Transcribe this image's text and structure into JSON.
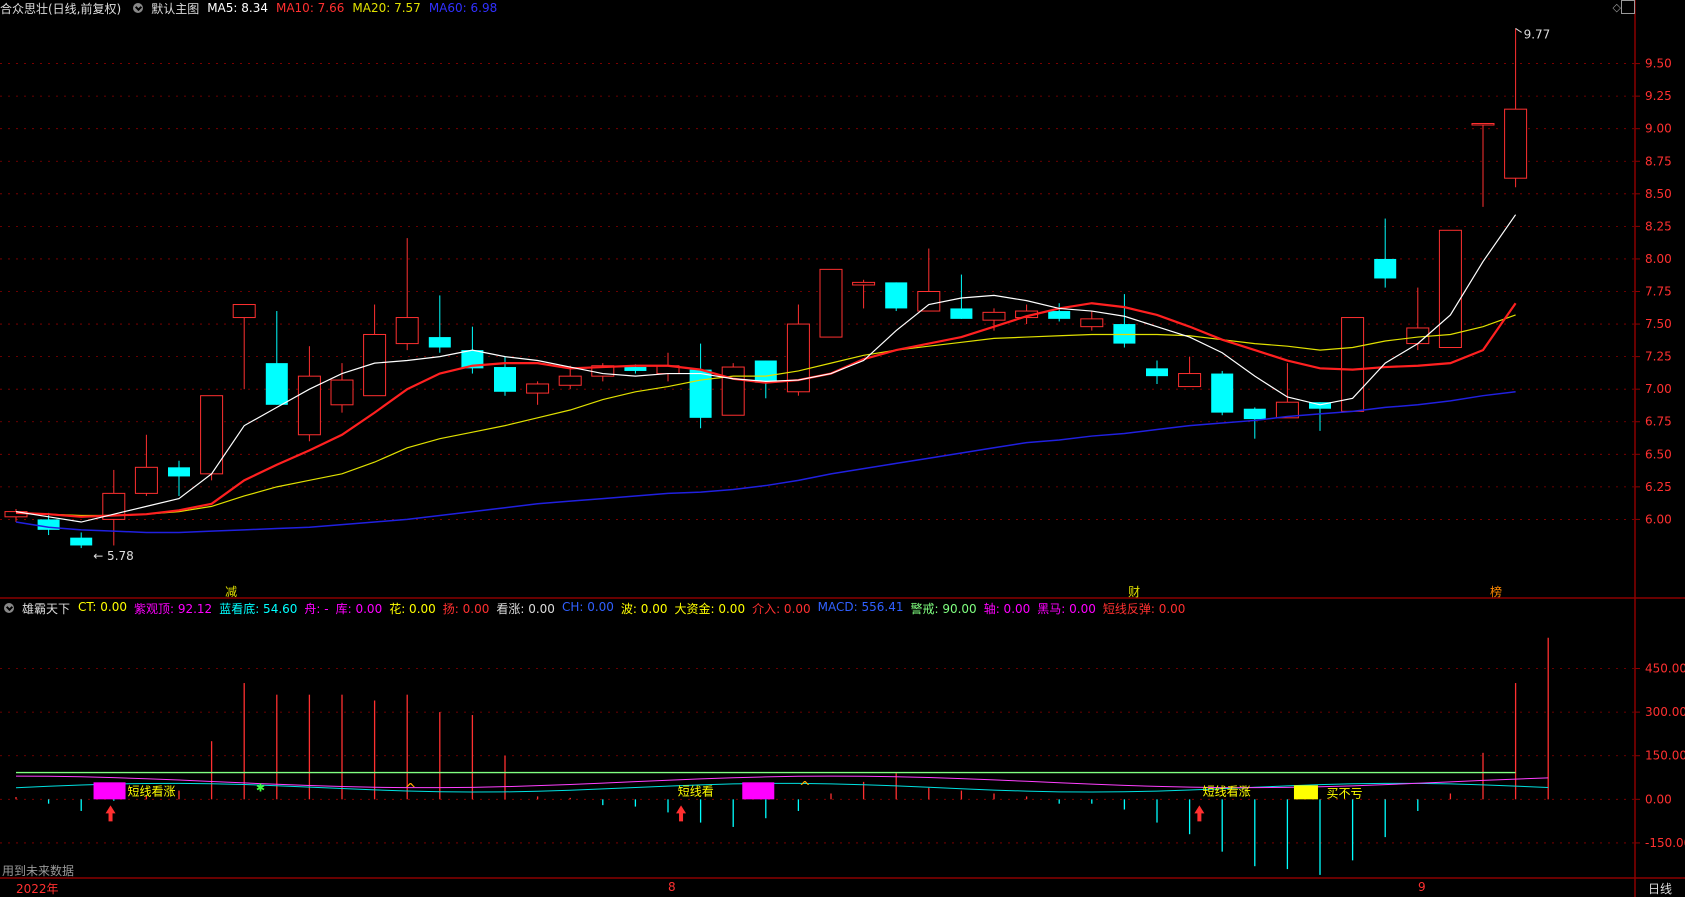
{
  "main_header": {
    "stock": "合众思壮(日线,前复权)",
    "template": "默认主图",
    "ma5": "MA5: 8.34",
    "ma10": "MA10: 7.66",
    "ma20": "MA20: 7.57",
    "ma60": "MA60: 6.98"
  },
  "indicator_header": {
    "name": "雄霸天下",
    "items": [
      {
        "text": "CT: 0.00",
        "color": "#ffff00"
      },
      {
        "text": "紫观顶: 92.12",
        "color": "#ff00ff"
      },
      {
        "text": "蓝看底: 54.60",
        "color": "#00ffff"
      },
      {
        "text": "舟: -",
        "color": "#ff00ff"
      },
      {
        "text": "库: 0.00",
        "color": "#ff00ff"
      },
      {
        "text": "花: 0.00",
        "color": "#ffff00"
      },
      {
        "text": "扬: 0.00",
        "color": "#ff3030"
      },
      {
        "text": "看涨: 0.00",
        "color": "#dddddd"
      },
      {
        "text": "CH: 0.00",
        "color": "#3060ff"
      },
      {
        "text": "波: 0.00",
        "color": "#ffff00"
      },
      {
        "text": "大资金: 0.00",
        "color": "#ffff00"
      },
      {
        "text": "介入: 0.00",
        "color": "#ff3030"
      },
      {
        "text": "MACD: 556.41",
        "color": "#3060ff"
      },
      {
        "text": "警戒: 90.00",
        "color": "#80ff80"
      },
      {
        "text": "轴: 0.00",
        "color": "#ff00ff"
      },
      {
        "text": "黑马: 0.00",
        "color": "#ff00ff"
      },
      {
        "text": "短线反弹: 0.00",
        "color": "#ff3030"
      }
    ]
  },
  "price_axis": [
    "9.50",
    "9.25",
    "9.00",
    "8.75",
    "8.50",
    "8.25",
    "8.00",
    "7.75",
    "7.50",
    "7.25",
    "7.00",
    "6.75",
    "6.50",
    "6.25",
    "6.00"
  ],
  "indicator_axis": [
    "450.00",
    "300.00",
    "150.00",
    "0.00",
    "-150.00"
  ],
  "annotations": {
    "high_label": "9.77",
    "low_label": "5.78",
    "marker_1": "减",
    "marker_2": "财",
    "marker_3": "榜"
  },
  "signal_labels": {
    "sig1": "短线看涨",
    "sig2": "短线看",
    "sig3": "短线看涨",
    "sig4": "买不亏"
  },
  "footer": {
    "future_data": "用到未来数据",
    "year_label": "2022年",
    "month_8": "8",
    "month_9": "9",
    "period": "日线"
  },
  "colors": {
    "up": "#ff3030",
    "down": "#00ffff",
    "ma5": "#ffffff",
    "ma10": "#ff2020",
    "ma20": "#e0e000",
    "ma60": "#2020e0",
    "grid": "#8b0000",
    "axis_text": "#ff3030"
  },
  "chart_data": {
    "type": "candlestick",
    "y_range": [
      5.65,
      9.85
    ],
    "candles": [
      {
        "o": 6.02,
        "h": 6.08,
        "l": 5.98,
        "c": 6.06
      },
      {
        "o": 6.0,
        "h": 6.05,
        "l": 5.88,
        "c": 5.92
      },
      {
        "o": 5.86,
        "h": 5.9,
        "l": 5.78,
        "c": 5.8
      },
      {
        "o": 6.0,
        "h": 6.38,
        "l": 5.8,
        "c": 6.2
      },
      {
        "o": 6.2,
        "h": 6.65,
        "l": 6.18,
        "c": 6.4
      },
      {
        "o": 6.4,
        "h": 6.45,
        "l": 6.18,
        "c": 6.33
      },
      {
        "o": 6.35,
        "h": 6.95,
        "l": 6.3,
        "c": 6.95
      },
      {
        "o": 7.55,
        "h": 7.65,
        "l": 7.0,
        "c": 7.65
      },
      {
        "o": 7.2,
        "h": 7.6,
        "l": 6.88,
        "c": 6.88
      },
      {
        "o": 6.65,
        "h": 7.33,
        "l": 6.6,
        "c": 7.1
      },
      {
        "o": 6.88,
        "h": 7.2,
        "l": 6.82,
        "c": 7.07
      },
      {
        "o": 6.95,
        "h": 7.65,
        "l": 6.95,
        "c": 7.42
      },
      {
        "o": 7.35,
        "h": 8.16,
        "l": 7.3,
        "c": 7.55
      },
      {
        "o": 7.4,
        "h": 7.72,
        "l": 7.28,
        "c": 7.32
      },
      {
        "o": 7.3,
        "h": 7.48,
        "l": 7.12,
        "c": 7.16
      },
      {
        "o": 7.17,
        "h": 7.25,
        "l": 6.95,
        "c": 6.98
      },
      {
        "o": 6.97,
        "h": 7.06,
        "l": 6.88,
        "c": 7.04
      },
      {
        "o": 7.03,
        "h": 7.18,
        "l": 7.0,
        "c": 7.1
      },
      {
        "o": 7.1,
        "h": 7.2,
        "l": 7.06,
        "c": 7.18
      },
      {
        "o": 7.17,
        "h": 7.19,
        "l": 7.12,
        "c": 7.14
      },
      {
        "o": 7.12,
        "h": 7.28,
        "l": 7.06,
        "c": 7.18
      },
      {
        "o": 7.15,
        "h": 7.35,
        "l": 6.7,
        "c": 6.78
      },
      {
        "o": 6.8,
        "h": 7.2,
        "l": 6.8,
        "c": 7.17
      },
      {
        "o": 7.22,
        "h": 7.22,
        "l": 6.93,
        "c": 7.05
      },
      {
        "o": 6.98,
        "h": 7.65,
        "l": 6.95,
        "c": 7.5
      },
      {
        "o": 7.4,
        "h": 7.92,
        "l": 7.4,
        "c": 7.92
      },
      {
        "o": 7.8,
        "h": 7.84,
        "l": 7.62,
        "c": 7.82
      },
      {
        "o": 7.82,
        "h": 7.82,
        "l": 7.6,
        "c": 7.62
      },
      {
        "o": 7.6,
        "h": 8.08,
        "l": 7.6,
        "c": 7.75
      },
      {
        "o": 7.62,
        "h": 7.88,
        "l": 7.54,
        "c": 7.54
      },
      {
        "o": 7.53,
        "h": 7.62,
        "l": 7.45,
        "c": 7.59
      },
      {
        "o": 7.55,
        "h": 7.65,
        "l": 7.5,
        "c": 7.6
      },
      {
        "o": 7.6,
        "h": 7.66,
        "l": 7.52,
        "c": 7.54
      },
      {
        "o": 7.48,
        "h": 7.6,
        "l": 7.45,
        "c": 7.54
      },
      {
        "o": 7.5,
        "h": 7.73,
        "l": 7.32,
        "c": 7.35
      },
      {
        "o": 7.16,
        "h": 7.22,
        "l": 7.04,
        "c": 7.1
      },
      {
        "o": 7.02,
        "h": 7.25,
        "l": 7.02,
        "c": 7.12
      },
      {
        "o": 7.12,
        "h": 7.14,
        "l": 6.8,
        "c": 6.82
      },
      {
        "o": 6.85,
        "h": 6.86,
        "l": 6.62,
        "c": 6.77
      },
      {
        "o": 6.78,
        "h": 7.2,
        "l": 6.78,
        "c": 6.9
      },
      {
        "o": 6.9,
        "h": 6.9,
        "l": 6.68,
        "c": 6.85
      },
      {
        "o": 6.83,
        "h": 7.55,
        "l": 6.83,
        "c": 7.55
      },
      {
        "o": 8.0,
        "h": 8.31,
        "l": 7.78,
        "c": 7.85
      },
      {
        "o": 7.35,
        "h": 7.78,
        "l": 7.3,
        "c": 7.47
      },
      {
        "o": 7.32,
        "h": 8.22,
        "l": 7.32,
        "c": 8.22
      },
      {
        "o": 9.04,
        "h": 9.04,
        "l": 8.4,
        "c": 9.04
      },
      {
        "o": 8.62,
        "h": 9.77,
        "l": 8.55,
        "c": 9.15
      }
    ],
    "ma5": [
      6.06,
      6.02,
      5.98,
      6.04,
      6.1,
      6.16,
      6.35,
      6.72,
      6.86,
      7.0,
      7.12,
      7.2,
      7.22,
      7.25,
      7.3,
      7.25,
      7.22,
      7.17,
      7.12,
      7.1,
      7.12,
      7.12,
      7.08,
      7.06,
      7.07,
      7.12,
      7.22,
      7.45,
      7.65,
      7.7,
      7.72,
      7.68,
      7.62,
      7.6,
      7.56,
      7.48,
      7.4,
      7.28,
      7.1,
      6.94,
      6.88,
      6.93,
      7.2,
      7.35,
      7.57,
      7.98,
      8.34
    ],
    "ma10": [
      6.05,
      6.04,
      6.02,
      6.03,
      6.04,
      6.07,
      6.12,
      6.3,
      6.42,
      6.53,
      6.65,
      6.82,
      7.0,
      7.12,
      7.18,
      7.2,
      7.2,
      7.16,
      7.17,
      7.18,
      7.18,
      7.15,
      7.08,
      7.05,
      7.07,
      7.12,
      7.23,
      7.3,
      7.35,
      7.4,
      7.48,
      7.56,
      7.62,
      7.66,
      7.63,
      7.57,
      7.48,
      7.38,
      7.3,
      7.22,
      7.16,
      7.15,
      7.17,
      7.18,
      7.2,
      7.3,
      7.66
    ],
    "ma20": [
      6.05,
      6.04,
      6.03,
      6.03,
      6.04,
      6.06,
      6.1,
      6.18,
      6.25,
      6.3,
      6.35,
      6.44,
      6.55,
      6.62,
      6.67,
      6.72,
      6.78,
      6.84,
      6.92,
      6.98,
      7.02,
      7.07,
      7.1,
      7.1,
      7.14,
      7.2,
      7.26,
      7.3,
      7.33,
      7.36,
      7.39,
      7.4,
      7.41,
      7.42,
      7.42,
      7.42,
      7.41,
      7.38,
      7.35,
      7.33,
      7.3,
      7.32,
      7.37,
      7.4,
      7.42,
      7.48,
      7.57
    ],
    "ma60": [
      5.98,
      5.94,
      5.92,
      5.91,
      5.9,
      5.9,
      5.91,
      5.92,
      5.93,
      5.94,
      5.96,
      5.98,
      6.0,
      6.03,
      6.06,
      6.09,
      6.12,
      6.14,
      6.16,
      6.18,
      6.2,
      6.21,
      6.23,
      6.26,
      6.3,
      6.35,
      6.39,
      6.43,
      6.47,
      6.51,
      6.55,
      6.59,
      6.61,
      6.64,
      6.66,
      6.69,
      6.72,
      6.74,
      6.76,
      6.79,
      6.81,
      6.83,
      6.86,
      6.88,
      6.91,
      6.95,
      6.98
    ],
    "macd_bars": [
      8,
      -15,
      -40,
      -5,
      12,
      30,
      200,
      400,
      360,
      360,
      360,
      340,
      360,
      300,
      290,
      150,
      10,
      5,
      -20,
      -25,
      -45,
      -80,
      -95,
      -65,
      -40,
      20,
      60,
      90,
      40,
      30,
      20,
      10,
      -15,
      -15,
      -35,
      -80,
      -120,
      -180,
      -230,
      -240,
      -260,
      -210,
      -130,
      -40,
      20,
      160,
      400,
      556
    ],
    "ind_y_range": [
      -250,
      610
    ]
  }
}
